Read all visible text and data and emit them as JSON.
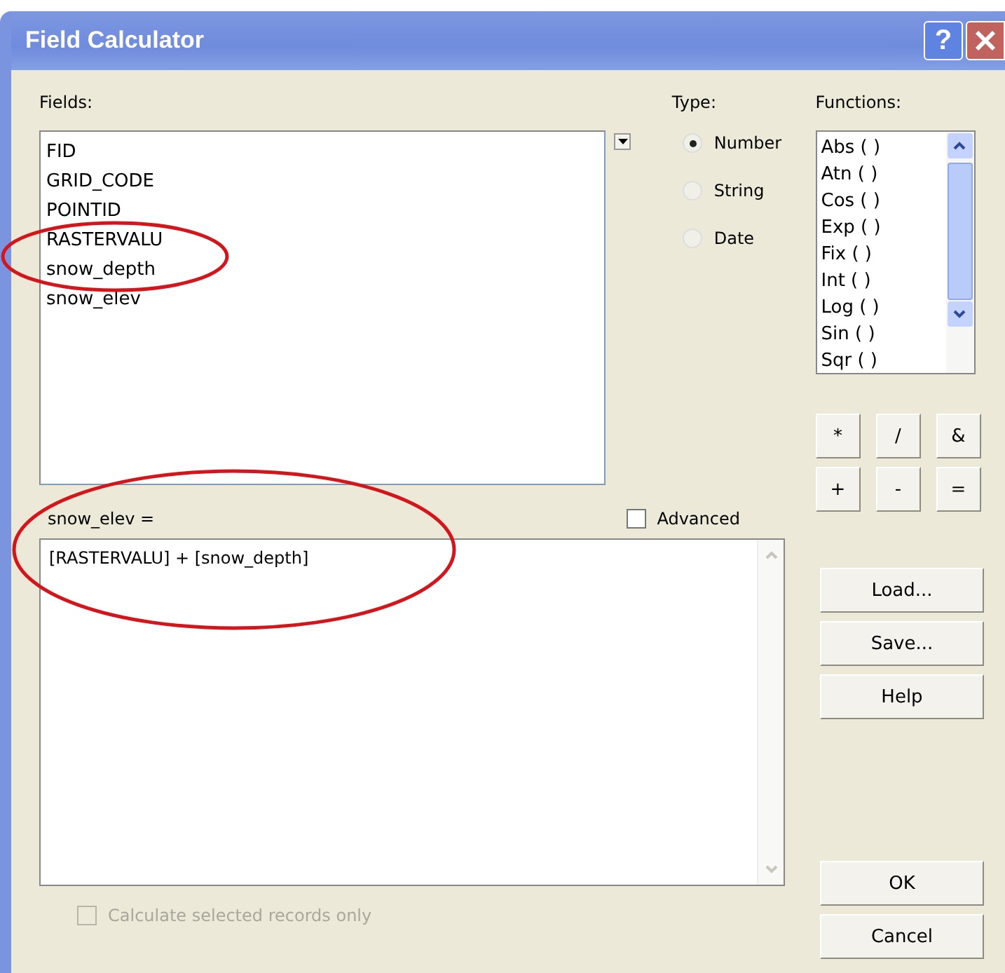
{
  "window": {
    "title": "Field Calculator",
    "help_button": "?"
  },
  "fields": {
    "label": "Fields:",
    "items": [
      "FID",
      "GRID_CODE",
      "POINTID",
      "RASTERVALU",
      "snow_depth",
      "snow_elev"
    ]
  },
  "type": {
    "label": "Type:",
    "options": [
      {
        "label": "Number",
        "selected": true
      },
      {
        "label": "String",
        "selected": false
      },
      {
        "label": "Date",
        "selected": false
      }
    ]
  },
  "functions": {
    "label": "Functions:",
    "items": [
      "Abs ( )",
      "Atn ( )",
      "Cos ( )",
      "Exp ( )",
      "Fix ( )",
      "Int ( )",
      "Log ( )",
      "Sin ( )",
      "Sqr ( )"
    ]
  },
  "operators": [
    "*",
    "/",
    "&",
    "+",
    "-",
    "="
  ],
  "expression": {
    "label": "snow_elev =",
    "value": "[RASTERVALU] + [snow_depth]"
  },
  "advanced": {
    "label": "Advanced",
    "checked": false
  },
  "side_buttons": [
    "Load...",
    "Save...",
    "Help"
  ],
  "selected_only": {
    "label": "Calculate selected records only",
    "checked": false,
    "disabled": true
  },
  "dialog_buttons": [
    "OK",
    "Cancel"
  ]
}
